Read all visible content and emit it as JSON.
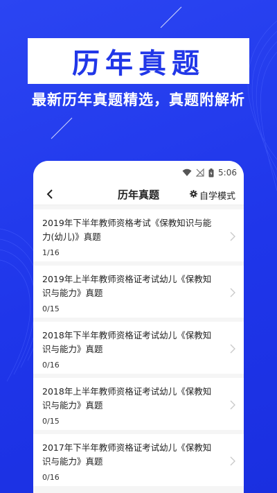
{
  "banner": {
    "title": "历年真题",
    "subtitle": "最新历年真题精选，真题附解析"
  },
  "status_bar": {
    "time": "5:06"
  },
  "nav": {
    "title": "历年真题",
    "mode_label": "自学模式"
  },
  "items": [
    {
      "title": "2019年下半年教师资格考试《保教知识与能力(幼儿)》真题",
      "progress": "1/16"
    },
    {
      "title": "2019年上半年教师资格证考试幼儿《保教知识与能力》真题",
      "progress": "0/15"
    },
    {
      "title": "2018年下半年教师资格证考试幼儿《保教知识与能力》真题",
      "progress": "0/16"
    },
    {
      "title": "2018年上半年教师资格证考试幼儿《保教知识与能力》真题",
      "progress": "0/15"
    },
    {
      "title": "2017年下半年教师资格证考试幼儿《保教知识与能力》真题",
      "progress": "0/16"
    }
  ],
  "icons": {
    "back": "chevron-left-icon",
    "mode": "gear-icon",
    "item_arrow": "chevron-right-icon",
    "wifi": "wifi-icon",
    "signal": "no-signal-icon",
    "battery": "battery-charging-icon"
  },
  "colors": {
    "background": "#1f36ea",
    "banner_text": "#2137e8"
  }
}
